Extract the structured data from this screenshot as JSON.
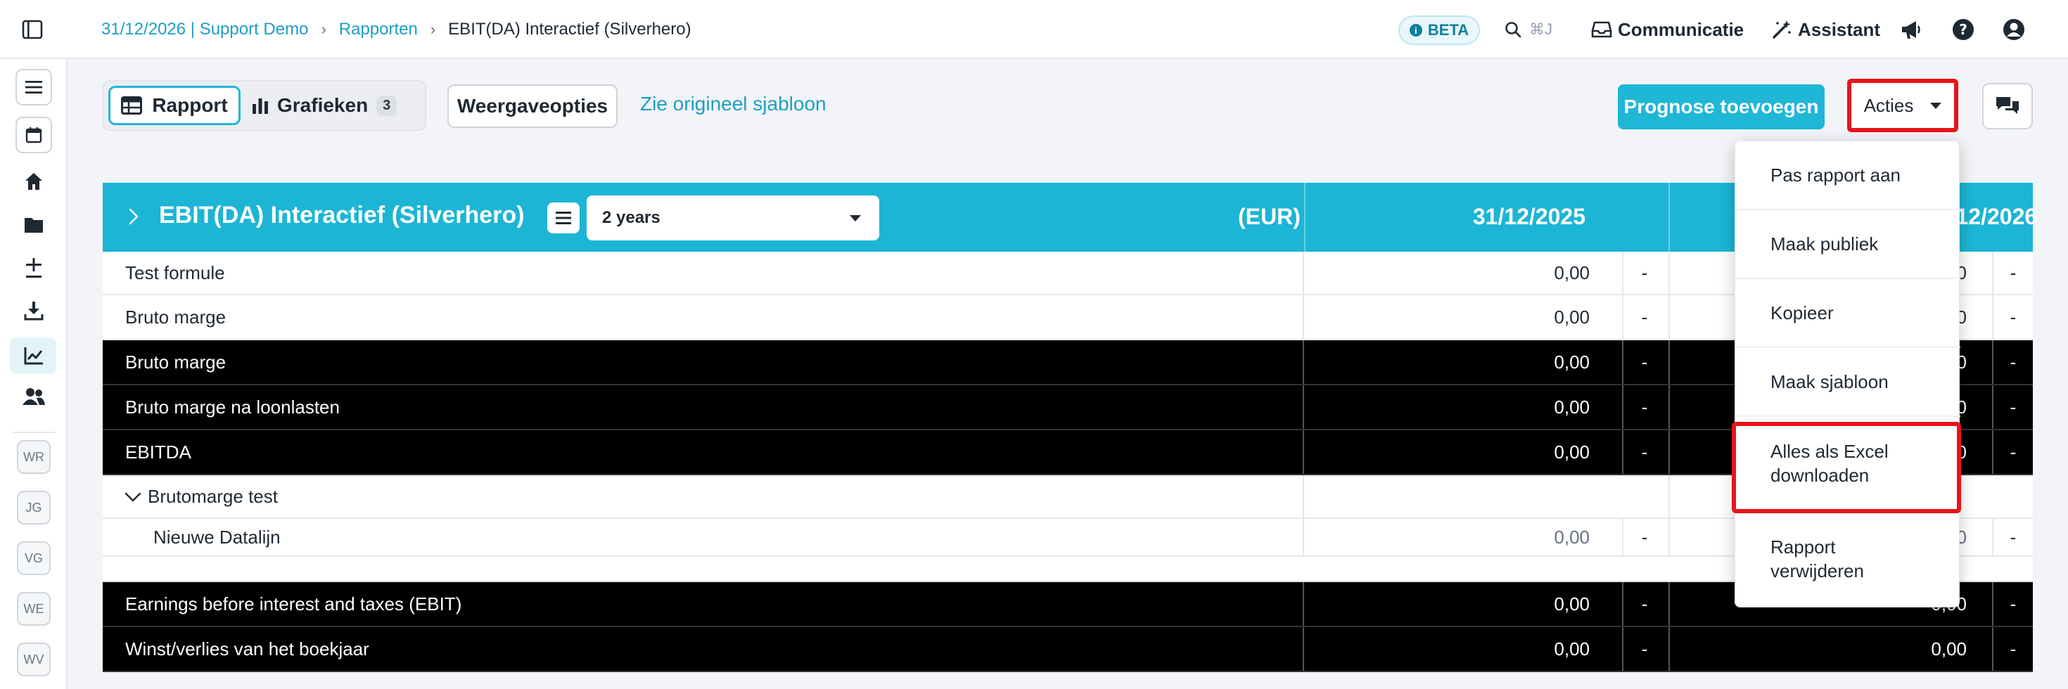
{
  "breadcrumb": {
    "org": "31/12/2026 | Support Demo",
    "section": "Rapporten",
    "current": "EBIT(DA) Interactief (Silverhero)"
  },
  "topbar": {
    "beta": "BETA",
    "search_shortcut": "⌘J",
    "communicatie": "Communicatie",
    "assistant": "Assistant"
  },
  "rail": {
    "avatars": [
      "WR",
      "JG",
      "VG",
      "WE",
      "WV"
    ]
  },
  "toolbar": {
    "tab_rapport": "Rapport",
    "tab_grafieken": "Grafieken",
    "grafieken_count": "3",
    "weergave": "Weergaveopties",
    "sjabloon_link": "Zie origineel sjabloon",
    "prognose": "Prognose toevoegen",
    "acties": "Acties"
  },
  "report": {
    "title": "EBIT(DA) Interactief (Silverhero)",
    "period_select": "2 years",
    "unit": "(EUR)",
    "col1": "31/12/2025",
    "col2": "31/12/2026",
    "rows": [
      {
        "label": "Test formule",
        "v1": "0,00",
        "d1": "-",
        "v2": "0,00",
        "d2": "-"
      },
      {
        "label": "Bruto marge",
        "v1": "0,00",
        "d1": "-",
        "v2": "0,00",
        "d2": "-"
      },
      {
        "label": "Bruto marge",
        "v1": "0,00",
        "d1": "-",
        "v2": "0,00",
        "d2": "-"
      },
      {
        "label": "Bruto marge na loonlasten",
        "v1": "0,00",
        "d1": "-",
        "v2": "0,00",
        "d2": "-"
      },
      {
        "label": "EBITDA",
        "v1": "0,00",
        "d1": "-",
        "v2": "0,00",
        "d2": "-"
      },
      {
        "label": "Brutomarge test"
      },
      {
        "label": "Nieuwe Datalijn",
        "v1": "0,00",
        "d1": "-",
        "v2": "0,00",
        "d2": "-"
      },
      {
        "label": "Earnings before interest and taxes (EBIT)",
        "v1": "0,00",
        "d1": "-",
        "v2": "0,00",
        "d2": "-"
      },
      {
        "label": "Winst/verlies van het boekjaar",
        "v1": "0,00",
        "d1": "-",
        "v2": "0,00",
        "d2": "-"
      }
    ]
  },
  "acties_menu": {
    "items": [
      "Pas rapport aan",
      "Maak publiek",
      "Kopieer",
      "Maak sjabloon",
      "Alles als Excel downloaden",
      "Rapport verwijderen"
    ]
  },
  "colors": {
    "accent": "#1cb5d5",
    "link": "#1b9fc4",
    "highlight": "#e8141a",
    "dark_row": "#000000"
  }
}
